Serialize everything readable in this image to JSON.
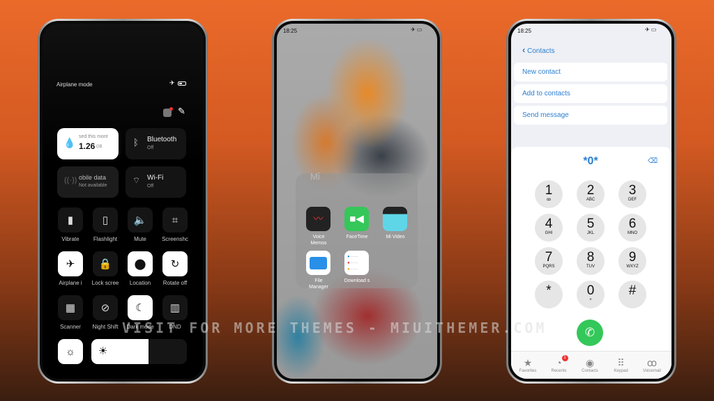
{
  "watermark": "VISIT FOR MORE THEMES - MIUITHEMER.COM",
  "control_center": {
    "status_label": "Airplane mode",
    "data_tile": {
      "caption": "sed this mont",
      "value": "1.26",
      "unit": "GB"
    },
    "bluetooth": {
      "title": "Bluetooth",
      "state": "Off"
    },
    "mobile_data": {
      "title": "obile data",
      "state": "Not available"
    },
    "wifi": {
      "title": "Wi-Fi",
      "state": "Off"
    },
    "toggles": [
      {
        "label": "Vibrate",
        "icon": "vibrate-icon",
        "on": false
      },
      {
        "label": "Flashlight",
        "icon": "flashlight-icon",
        "on": false
      },
      {
        "label": "Mute",
        "icon": "speaker-icon",
        "on": false
      },
      {
        "label": "Screenshc",
        "icon": "screenshot-icon",
        "on": false
      },
      {
        "label": "Airplane i",
        "icon": "airplane-icon",
        "on": true
      },
      {
        "label": "Lock scree",
        "icon": "lock-icon",
        "on": false
      },
      {
        "label": "Location",
        "icon": "location-icon",
        "on": true
      },
      {
        "label": "Rotate off",
        "icon": "rotate-lock-icon",
        "on": true
      },
      {
        "label": "Scanner",
        "icon": "qr-scanner-icon",
        "on": false
      },
      {
        "label": "Night Shift",
        "icon": "eye-off-icon",
        "on": false
      },
      {
        "label": "Dark mode",
        "icon": "moon-icon",
        "on": true
      },
      {
        "label": "DND",
        "icon": "book-icon",
        "on": false
      }
    ],
    "brightness_percent": 60
  },
  "folder": {
    "time": "18:25",
    "name": "Mi",
    "apps": [
      {
        "label": "Voice Memos",
        "icon": "voice-memos-icon"
      },
      {
        "label": "FaceTime",
        "icon": "facetime-icon"
      },
      {
        "label": "Mi Video",
        "icon": "video-clapper-icon"
      },
      {
        "label": "File Manager",
        "icon": "folder-icon"
      },
      {
        "label": "Download s",
        "icon": "downloads-list-icon"
      }
    ]
  },
  "dialer": {
    "time": "18:25",
    "back_label": "Contacts",
    "actions": [
      "New contact",
      "Add to contacts",
      "Send message"
    ],
    "input": "*0*",
    "keys": [
      {
        "d": "1",
        "l": "ꝏ"
      },
      {
        "d": "2",
        "l": "ABC"
      },
      {
        "d": "3",
        "l": "DEF"
      },
      {
        "d": "4",
        "l": "GHI"
      },
      {
        "d": "5",
        "l": "JKL"
      },
      {
        "d": "6",
        "l": "MNO"
      },
      {
        "d": "7",
        "l": "PQRS"
      },
      {
        "d": "8",
        "l": "TUV"
      },
      {
        "d": "9",
        "l": "WXYZ"
      },
      {
        "d": "*",
        "l": ""
      },
      {
        "d": "0",
        "l": "+"
      },
      {
        "d": "#",
        "l": ""
      }
    ],
    "tabs": [
      {
        "label": "Favorites",
        "icon": "star-icon"
      },
      {
        "label": "Recents",
        "icon": "clock-icon",
        "badge": "1"
      },
      {
        "label": "Contacts",
        "icon": "person-circle-icon"
      },
      {
        "label": "Keypad",
        "icon": "keypad-icon"
      },
      {
        "label": "Voicemail",
        "icon": "voicemail-icon"
      }
    ],
    "accent": "#2b7fd0",
    "call_color": "#34c759"
  }
}
